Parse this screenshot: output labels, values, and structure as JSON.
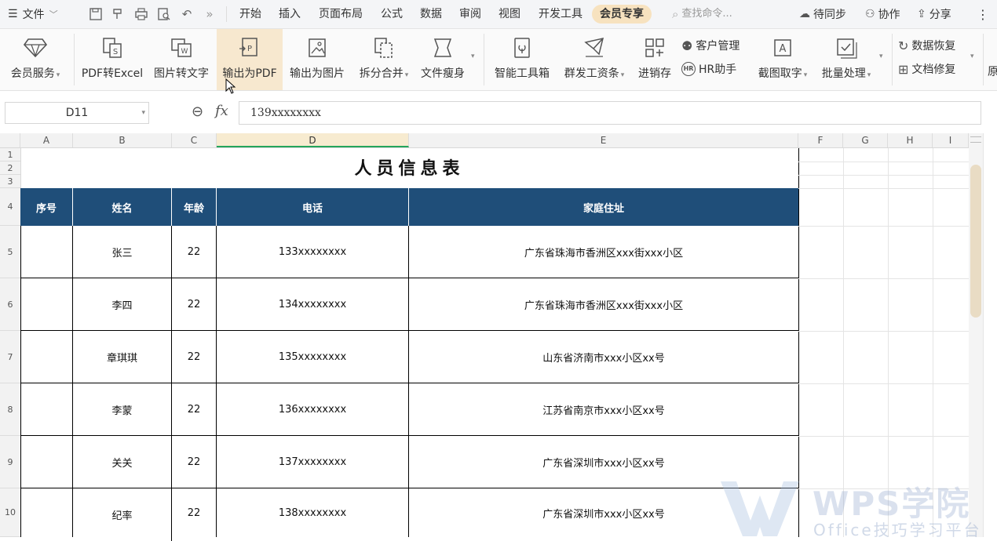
{
  "menubar": {
    "file_label": "文件",
    "tabs": [
      "开始",
      "插入",
      "页面布局",
      "公式",
      "数据",
      "审阅",
      "视图",
      "开发工具",
      "会员专享"
    ],
    "active_tab": "会员专享",
    "search_placeholder": "查找命令...",
    "sync": "待同步",
    "collab": "协作",
    "share": "分享"
  },
  "ribbon": {
    "vip_service": "会员服务",
    "pdf_to_excel": "PDF转Excel",
    "img_to_text": "图片转文字",
    "export_pdf": "输出为PDF",
    "export_img": "输出为图片",
    "split_merge": "拆分合并",
    "file_slim": "文件瘦身",
    "smart_tools": "智能工具箱",
    "send_salary": "群发工资条",
    "inventory": "进销存",
    "crm": "客户管理",
    "hr": "HR助手",
    "ocr": "截图取字",
    "batch": "批量处理",
    "data_recover": "数据恢复",
    "doc_repair": "文档修复",
    "more_label": "原"
  },
  "formula": {
    "cell_ref": "D11",
    "fx": "fx",
    "value": "139xxxxxxxx"
  },
  "grid": {
    "columns": [
      "A",
      "B",
      "C",
      "D",
      "E",
      "F",
      "G",
      "H",
      "I"
    ],
    "rows": [
      "1",
      "2",
      "3",
      "4",
      "5",
      "6",
      "7",
      "8",
      "9",
      "10"
    ]
  },
  "sheet": {
    "title": "人员信息表",
    "headers": [
      "序号",
      "姓名",
      "年龄",
      "电话",
      "家庭住址"
    ],
    "records": [
      {
        "name": "张三",
        "age": "22",
        "phone": "133xxxxxxxx",
        "address": "广东省珠海市香洲区xxx街xxx小区"
      },
      {
        "name": "李四",
        "age": "22",
        "phone": "134xxxxxxxx",
        "address": "广东省珠海市香洲区xxx街xxx小区"
      },
      {
        "name": "章琪琪",
        "age": "22",
        "phone": "135xxxxxxxx",
        "address": "山东省济南市xxx小区xx号"
      },
      {
        "name": "李蒙",
        "age": "22",
        "phone": "136xxxxxxxx",
        "address": "江苏省南京市xxx小区xx号"
      },
      {
        "name": "关关",
        "age": "22",
        "phone": "137xxxxxxxx",
        "address": "广东省深圳市xxx小区xx号"
      },
      {
        "name": "纪率",
        "age": "22",
        "phone": "138xxxxxxxx",
        "address": "广东省深圳市xxx小区xx号"
      }
    ]
  },
  "watermark": {
    "brand": "WPS学院",
    "tagline": "Office技巧学习平台"
  },
  "colors": {
    "header_bg": "#1f4e79",
    "active_tab_bg": "#f7e2bf",
    "selected_col": "#f7ebd0"
  }
}
